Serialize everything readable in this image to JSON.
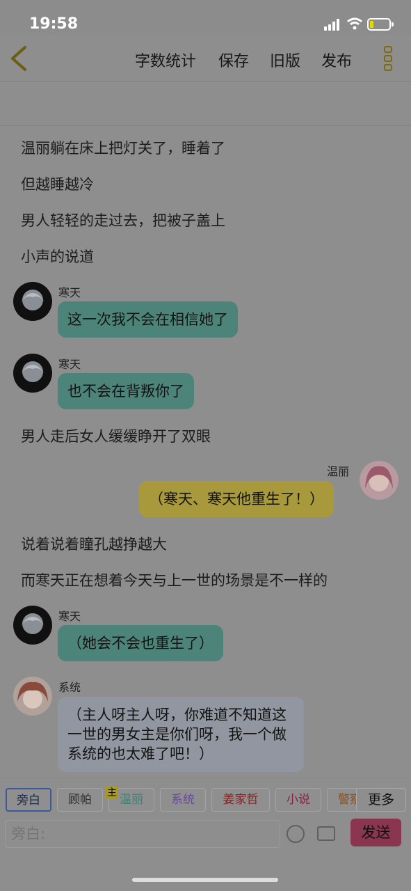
{
  "status": {
    "time": "19:58"
  },
  "header": {
    "back_label": "",
    "word_count": "字数统计",
    "save": "保存",
    "old_version": "旧版",
    "publish": "发布"
  },
  "messages": [
    {
      "type": "narration",
      "text": "温丽躺在床上把灯关了，睡着了"
    },
    {
      "type": "narration",
      "text": "但越睡越冷"
    },
    {
      "type": "narration",
      "text": "男人轻轻的走过去，把被子盖上"
    },
    {
      "type": "narration",
      "text": "小声的说道"
    },
    {
      "type": "chat",
      "speaker": "寒天",
      "text": "这一次我不会在相信她了"
    },
    {
      "type": "chat",
      "speaker": "寒天",
      "text": "也不会在背叛你了"
    },
    {
      "type": "narration",
      "text": "男人走后女人缓缓睁开了双眼"
    },
    {
      "type": "chat",
      "speaker": "温丽",
      "text": "（寒天、寒天他重生了！）"
    },
    {
      "type": "narration",
      "text": "说着说着瞳孔越挣越大"
    },
    {
      "type": "narration",
      "text": "而寒天正在想着今天与上一世的场景是不一样的"
    },
    {
      "type": "chat",
      "speaker": "寒天",
      "text": "（她会不会也重生了）"
    },
    {
      "type": "chat",
      "speaker": "系统",
      "text": "（主人呀主人呀，你难道不知道这一世的男女主是你们呀，我一个做系统的也太难了吧！）"
    }
  ],
  "characters": {
    "chips": [
      "旁白",
      "顾帕",
      "温丽",
      "系统",
      "姜家哲",
      "小说",
      "警察"
    ],
    "main_marker": "主",
    "more": "更多",
    "colors": [
      "#1a2a4a",
      "#2b2b2b",
      "#3f7f74",
      "#6a4a9a",
      "#8a2020",
      "#8a2040",
      "#8a5020"
    ]
  },
  "composer": {
    "placeholder": "旁白:",
    "send": "发送"
  }
}
